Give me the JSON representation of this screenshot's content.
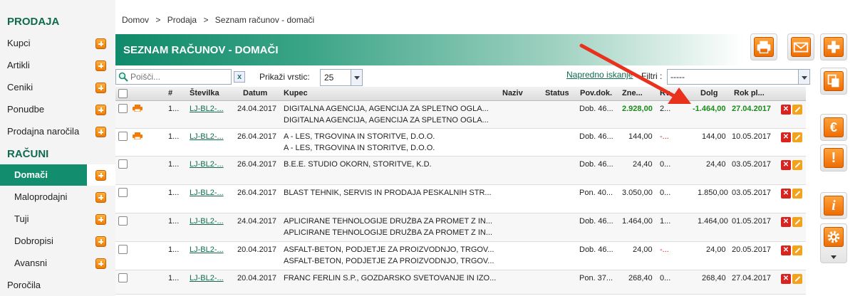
{
  "sidebar": {
    "section_sales": "PRODAJA",
    "items": [
      {
        "label": "Kupci"
      },
      {
        "label": "Artikli"
      },
      {
        "label": "Ceniki"
      },
      {
        "label": "Ponudbe"
      },
      {
        "label": "Prodajna naročila"
      }
    ],
    "section_invoices": "RAČUNI",
    "sub_items": [
      {
        "label": "Domači"
      },
      {
        "label": "Maloprodajni"
      },
      {
        "label": "Tuji"
      },
      {
        "label": "Dobropisi"
      },
      {
        "label": "Avansni"
      }
    ],
    "reports": "Poročila"
  },
  "breadcrumb": {
    "home": "Domov",
    "sep": ">",
    "sales": "Prodaja",
    "current": "Seznam računov - domači"
  },
  "page_title": "SEZNAM RAČUNOV - DOMAČI",
  "toolbar": {
    "search_placeholder": "Poišči...",
    "clear": "x",
    "rows_label": "Prikaži vrstic:",
    "rows_value": "25",
    "advanced_search": "Napredno iskanje",
    "filters_label": "Filtri :",
    "filters_value": "-----"
  },
  "table": {
    "headers": {
      "num": "#",
      "number": "Številka",
      "date": "Datum",
      "customer": "Kupec",
      "name": "Naziv",
      "status": "Status",
      "doc": "Pov.dok.",
      "amount": "Zne...",
      "due": "Rv...",
      "debt": "Dolg",
      "deadline": "Rok pl..."
    },
    "rows": [
      {
        "num": "1...",
        "number": "LJ-BL2-...",
        "date": "24.04.2017",
        "customer1": "DIGITALNA AGENCIJA, AGENCIJA ZA SPLETNO OGLA...",
        "customer2": "DIGITALNA AGENCIJA, AGENCIJA ZA SPLETNO OGLA...",
        "doc": "Dob. 46...",
        "amount": "2.928,00",
        "due": "2...",
        "debt": "-1.464,00",
        "deadline": "27.04.2017"
      },
      {
        "num": "1...",
        "number": "LJ-BL2-...",
        "date": "26.04.2017",
        "customer1": "A - LES, TRGOVINA IN STORITVE, D.O.O.",
        "customer2": "A - LES, TRGOVINA IN STORITVE, D.O.O.",
        "doc": "Dob. 46...",
        "amount": "144,00",
        "due": "-...",
        "debt": "144,00",
        "deadline": "10.05.2017"
      },
      {
        "num": "1...",
        "number": "LJ-BL2-...",
        "date": "26.04.2017",
        "customer1": "B.E.E. STUDIO OKORN, STORITVE, K.D.",
        "customer2": "",
        "doc": "Dob. 46...",
        "amount": "24,40",
        "due": "0...",
        "debt": "24,40",
        "deadline": "03.05.2017"
      },
      {
        "num": "1...",
        "number": "LJ-BL2-...",
        "date": "26.04.2017",
        "customer1": "BLAST TEHNIK, SERVIS IN PRODAJA PESKALNIH STR...",
        "customer2": "",
        "doc": "Pon. 40...",
        "amount": "3.050,00",
        "due": "0...",
        "debt": "1.850,00",
        "deadline": "03.05.2017"
      },
      {
        "num": "1...",
        "number": "LJ-BL2-...",
        "date": "24.04.2017",
        "customer1": "APLICIRANE TEHNOLOGIJE DRUŽBA ZA PROMET Z IN...",
        "customer2": "APLICIRANE TEHNOLOGIJE DRUŽBA ZA PROMET Z IN...",
        "doc": "Dob. 46...",
        "amount": "1.464,00",
        "due": "1...",
        "debt": "1.464,00",
        "deadline": "01.05.2017"
      },
      {
        "num": "1...",
        "number": "LJ-BL2-...",
        "date": "20.04.2017",
        "customer1": "ASFALT-BETON, PODJETJE ZA PROIZVODNJO, TRGOV...",
        "customer2": "ASFALT-BETON, PODJETJE ZA PROIZVODNJO, TRGOV...",
        "doc": "Dob. 46...",
        "amount": "24,00",
        "due": "-...",
        "debt": "24,00",
        "deadline": "20.05.2017"
      },
      {
        "num": "1...",
        "number": "LJ-BL2-...",
        "date": "20.04.2017",
        "customer1": "FRANC FERLIN S.P., GOZDARSKO SVETOVANJE IN IZO...",
        "customer2": "",
        "doc": "Pon. 37...",
        "amount": "268,40",
        "due": "0...",
        "debt": "268,40",
        "deadline": "27.04.2017"
      }
    ],
    "delete_glyph": "✕"
  },
  "actions": {
    "euro": "€",
    "alert": "!",
    "info": "i"
  },
  "colors": {
    "brand_green": "#128d6d",
    "accent_orange": "#f07b06",
    "positive": "#1a8c1a",
    "negative": "#d21a1a",
    "annotation": "#e8321e"
  }
}
